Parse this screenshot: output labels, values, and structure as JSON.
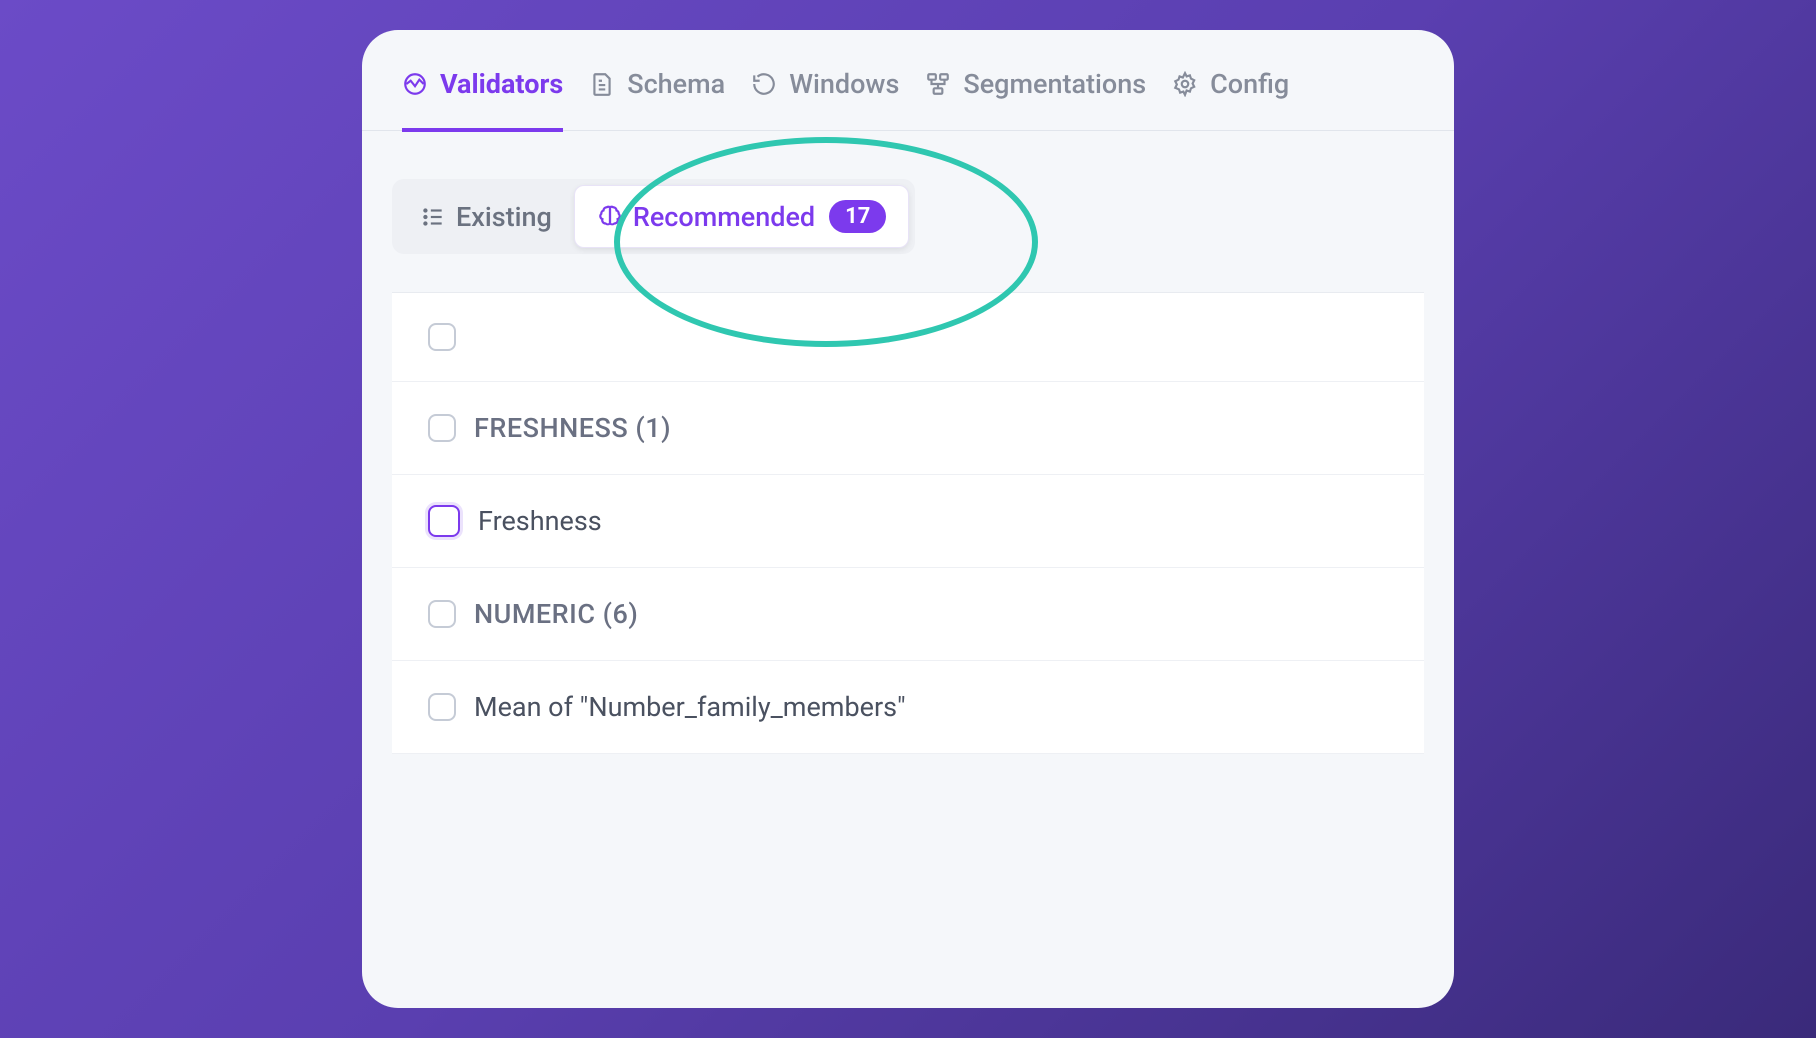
{
  "primary_tabs": {
    "validators": "Validators",
    "schema": "Schema",
    "windows": "Windows",
    "segmentations": "Segmentations",
    "config": "Config"
  },
  "sub_tabs": {
    "existing": "Existing",
    "recommended": "Recommended",
    "recommended_count": "17"
  },
  "list": {
    "group_freshness": "FRESHNESS (1)",
    "item_freshness": "Freshness",
    "group_numeric": "NUMERIC (6)",
    "item_mean_family": "Mean of \"Number_family_members\""
  }
}
